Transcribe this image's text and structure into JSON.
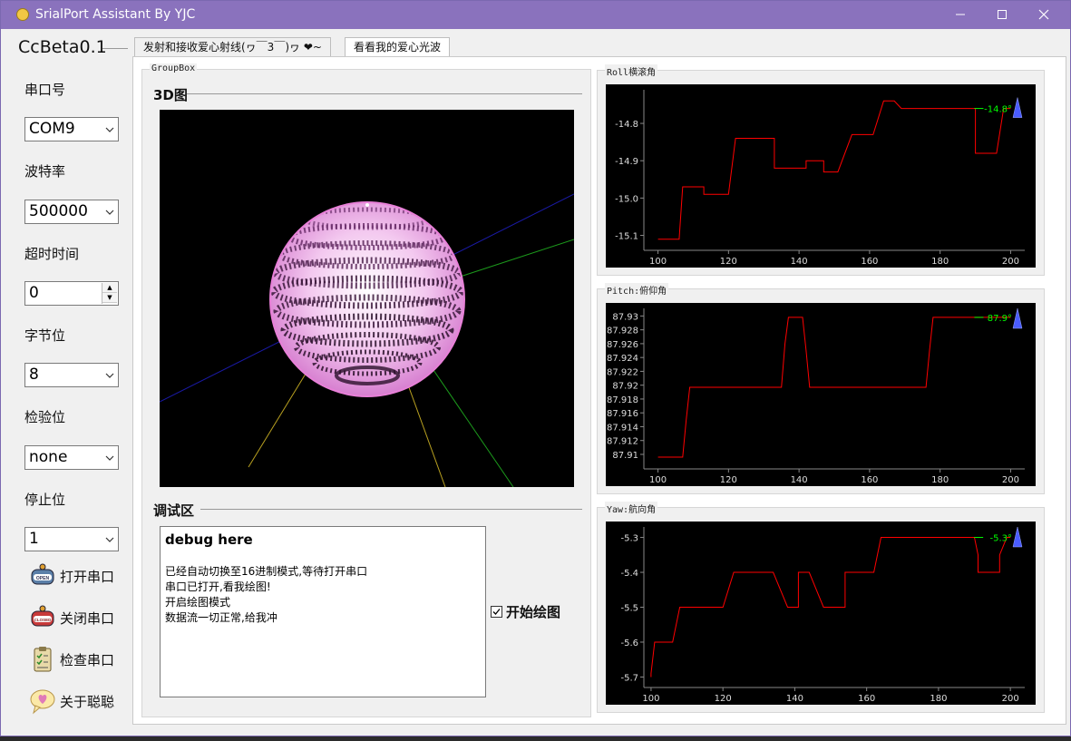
{
  "window": {
    "title": "SrialPort Assistant By YJC",
    "minimize": "—",
    "maximize": "☐",
    "close": "✕"
  },
  "left": {
    "version": "CcBeta0.1",
    "port_label": "串口号",
    "port_value": "COM9",
    "baud_label": "波特率",
    "baud_value": "500000",
    "timeout_label": "超时时间",
    "timeout_value": "0",
    "bytesize_label": "字节位",
    "bytesize_value": "8",
    "parity_label": "检验位",
    "parity_value": "none",
    "stopbits_label": "停止位",
    "stopbits_value": "1",
    "open_label": "打开串口",
    "close_label": "关闭串口",
    "check_label": "检查串口",
    "about_label": "关于聪聪",
    "open_icon_text": "OPEN",
    "closed_icon_text": "CLOSED"
  },
  "tabs": [
    {
      "label": "发射和接收爱心射线(ヮ￣3￣)ヮ ❤~"
    },
    {
      "label": "看看我的爱心光波"
    }
  ],
  "groupbox": {
    "title": "GroupBox",
    "view3d_title": "3D图",
    "debug_title": "调试区"
  },
  "debug": {
    "head": "debug here",
    "lines": [
      "已经自动切换至16进制模式,等待打开串口",
      "串口已打开,看我绘图!",
      "开启绘图模式",
      "数据流一切正常,给我冲"
    ]
  },
  "start_plot_label": "开始绘图",
  "colors": {
    "titlebar": "#8a72bd",
    "plot_line": "#ff0000",
    "readout": "#00ff00",
    "marker": "#4a5cff"
  },
  "chart_data": [
    {
      "type": "line",
      "title": "Roll横滚角",
      "x": [
        100,
        106,
        106,
        107,
        107,
        113,
        113,
        120,
        120,
        122,
        122,
        133,
        133,
        139,
        139,
        142,
        142,
        147,
        147,
        151,
        151,
        155,
        155,
        161,
        161,
        164,
        164,
        167,
        167,
        169,
        169,
        174,
        174,
        180,
        180,
        189,
        189,
        190,
        190,
        196,
        196,
        198,
        198,
        200
      ],
      "y": [
        -15.11,
        -15.11,
        -15.11,
        -14.97,
        -14.97,
        -14.97,
        -14.99,
        -14.99,
        -14.99,
        -14.84,
        -14.84,
        -14.84,
        -14.92,
        -14.92,
        -14.92,
        -14.92,
        -14.9,
        -14.9,
        -14.93,
        -14.93,
        -14.93,
        -14.83,
        -14.83,
        -14.83,
        -14.83,
        -14.74,
        -14.74,
        -14.74,
        -14.74,
        -14.76,
        -14.76,
        -14.76,
        -14.76,
        -14.76,
        -14.76,
        -14.76,
        -14.76,
        -14.76,
        -14.88,
        -14.88,
        -14.88,
        -14.76,
        -14.76,
        -14.76
      ],
      "yticks": [
        "-14.8",
        "-14.9",
        "-15.0",
        "-15.1"
      ],
      "xticks": [
        "100",
        "120",
        "140",
        "160",
        "180",
        "200"
      ],
      "ylim": [
        -15.14,
        -14.71
      ],
      "xlim": [
        96,
        204
      ],
      "readout": "-14.8°"
    },
    {
      "type": "line",
      "title": "Pitch:俯仰角",
      "x": [
        100,
        107,
        108,
        109,
        135,
        136,
        137,
        141,
        142,
        143,
        176,
        177,
        178,
        200
      ],
      "y": [
        87.9096,
        87.9096,
        87.915,
        87.9197,
        87.9197,
        87.926,
        87.9298,
        87.9298,
        87.925,
        87.9197,
        87.9197,
        87.925,
        87.9298,
        87.9298
      ],
      "yticks": [
        "87.93",
        "87.928",
        "87.926",
        "87.924",
        "87.922",
        "87.92",
        "87.918",
        "87.916",
        "87.914",
        "87.912",
        "87.91"
      ],
      "xticks": [
        "100",
        "120",
        "140",
        "160",
        "180",
        "200"
      ],
      "ylim": [
        87.9079,
        87.9311
      ],
      "xlim": [
        96,
        204
      ],
      "readout": "87.9°"
    },
    {
      "type": "line",
      "title": "Yaw:航向角",
      "x": [
        100,
        100,
        100,
        101,
        101,
        106,
        106,
        108,
        108,
        120,
        120,
        123,
        123,
        134,
        134,
        138,
        138,
        141,
        141,
        144,
        144,
        148,
        148,
        154,
        154,
        156,
        156,
        162,
        162,
        164,
        164,
        167,
        167,
        190,
        190,
        191,
        191,
        197,
        197,
        199,
        199,
        200
      ],
      "y": [
        -5.7,
        -5.69,
        -5.69,
        -5.6,
        -5.6,
        -5.6,
        -5.6,
        -5.5,
        -5.5,
        -5.5,
        -5.5,
        -5.4,
        -5.4,
        -5.4,
        -5.4,
        -5.5,
        -5.5,
        -5.5,
        -5.4,
        -5.4,
        -5.4,
        -5.5,
        -5.5,
        -5.5,
        -5.4,
        -5.4,
        -5.4,
        -5.4,
        -5.4,
        -5.3,
        -5.3,
        -5.3,
        -5.3,
        -5.3,
        -5.3,
        -5.35,
        -5.4,
        -5.4,
        -5.35,
        -5.3,
        -5.3,
        -5.3
      ],
      "yticks": [
        "-5.3",
        "-5.4",
        "-5.5",
        "-5.6",
        "-5.7"
      ],
      "xticks": [
        "100",
        "120",
        "140",
        "160",
        "180",
        "200"
      ],
      "ylim": [
        -5.73,
        -5.27
      ],
      "xlim": [
        98,
        204
      ],
      "readout": "-5.3°"
    }
  ]
}
